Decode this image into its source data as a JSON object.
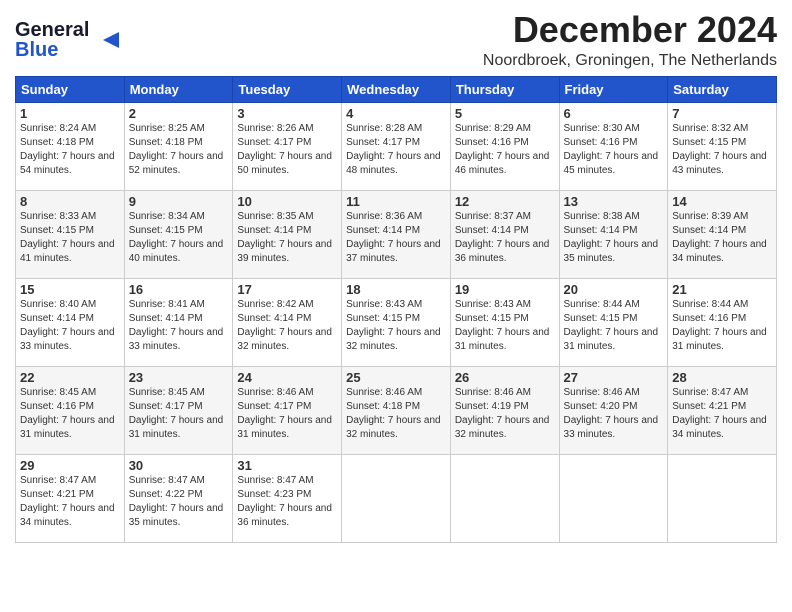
{
  "logo": {
    "line1": "General",
    "line2": "Blue"
  },
  "title": "December 2024",
  "location": "Noordbroek, Groningen, The Netherlands",
  "days_of_week": [
    "Sunday",
    "Monday",
    "Tuesday",
    "Wednesday",
    "Thursday",
    "Friday",
    "Saturday"
  ],
  "weeks": [
    [
      {
        "day": "1",
        "sunrise": "8:24 AM",
        "sunset": "4:18 PM",
        "daylight": "7 hours and 54 minutes."
      },
      {
        "day": "2",
        "sunrise": "8:25 AM",
        "sunset": "4:18 PM",
        "daylight": "7 hours and 52 minutes."
      },
      {
        "day": "3",
        "sunrise": "8:26 AM",
        "sunset": "4:17 PM",
        "daylight": "7 hours and 50 minutes."
      },
      {
        "day": "4",
        "sunrise": "8:28 AM",
        "sunset": "4:17 PM",
        "daylight": "7 hours and 48 minutes."
      },
      {
        "day": "5",
        "sunrise": "8:29 AM",
        "sunset": "4:16 PM",
        "daylight": "7 hours and 46 minutes."
      },
      {
        "day": "6",
        "sunrise": "8:30 AM",
        "sunset": "4:16 PM",
        "daylight": "7 hours and 45 minutes."
      },
      {
        "day": "7",
        "sunrise": "8:32 AM",
        "sunset": "4:15 PM",
        "daylight": "7 hours and 43 minutes."
      }
    ],
    [
      {
        "day": "8",
        "sunrise": "8:33 AM",
        "sunset": "4:15 PM",
        "daylight": "7 hours and 41 minutes."
      },
      {
        "day": "9",
        "sunrise": "8:34 AM",
        "sunset": "4:15 PM",
        "daylight": "7 hours and 40 minutes."
      },
      {
        "day": "10",
        "sunrise": "8:35 AM",
        "sunset": "4:14 PM",
        "daylight": "7 hours and 39 minutes."
      },
      {
        "day": "11",
        "sunrise": "8:36 AM",
        "sunset": "4:14 PM",
        "daylight": "7 hours and 37 minutes."
      },
      {
        "day": "12",
        "sunrise": "8:37 AM",
        "sunset": "4:14 PM",
        "daylight": "7 hours and 36 minutes."
      },
      {
        "day": "13",
        "sunrise": "8:38 AM",
        "sunset": "4:14 PM",
        "daylight": "7 hours and 35 minutes."
      },
      {
        "day": "14",
        "sunrise": "8:39 AM",
        "sunset": "4:14 PM",
        "daylight": "7 hours and 34 minutes."
      }
    ],
    [
      {
        "day": "15",
        "sunrise": "8:40 AM",
        "sunset": "4:14 PM",
        "daylight": "7 hours and 33 minutes."
      },
      {
        "day": "16",
        "sunrise": "8:41 AM",
        "sunset": "4:14 PM",
        "daylight": "7 hours and 33 minutes."
      },
      {
        "day": "17",
        "sunrise": "8:42 AM",
        "sunset": "4:14 PM",
        "daylight": "7 hours and 32 minutes."
      },
      {
        "day": "18",
        "sunrise": "8:43 AM",
        "sunset": "4:15 PM",
        "daylight": "7 hours and 32 minutes."
      },
      {
        "day": "19",
        "sunrise": "8:43 AM",
        "sunset": "4:15 PM",
        "daylight": "7 hours and 31 minutes."
      },
      {
        "day": "20",
        "sunrise": "8:44 AM",
        "sunset": "4:15 PM",
        "daylight": "7 hours and 31 minutes."
      },
      {
        "day": "21",
        "sunrise": "8:44 AM",
        "sunset": "4:16 PM",
        "daylight": "7 hours and 31 minutes."
      }
    ],
    [
      {
        "day": "22",
        "sunrise": "8:45 AM",
        "sunset": "4:16 PM",
        "daylight": "7 hours and 31 minutes."
      },
      {
        "day": "23",
        "sunrise": "8:45 AM",
        "sunset": "4:17 PM",
        "daylight": "7 hours and 31 minutes."
      },
      {
        "day": "24",
        "sunrise": "8:46 AM",
        "sunset": "4:17 PM",
        "daylight": "7 hours and 31 minutes."
      },
      {
        "day": "25",
        "sunrise": "8:46 AM",
        "sunset": "4:18 PM",
        "daylight": "7 hours and 32 minutes."
      },
      {
        "day": "26",
        "sunrise": "8:46 AM",
        "sunset": "4:19 PM",
        "daylight": "7 hours and 32 minutes."
      },
      {
        "day": "27",
        "sunrise": "8:46 AM",
        "sunset": "4:20 PM",
        "daylight": "7 hours and 33 minutes."
      },
      {
        "day": "28",
        "sunrise": "8:47 AM",
        "sunset": "4:21 PM",
        "daylight": "7 hours and 34 minutes."
      }
    ],
    [
      {
        "day": "29",
        "sunrise": "8:47 AM",
        "sunset": "4:21 PM",
        "daylight": "7 hours and 34 minutes."
      },
      {
        "day": "30",
        "sunrise": "8:47 AM",
        "sunset": "4:22 PM",
        "daylight": "7 hours and 35 minutes."
      },
      {
        "day": "31",
        "sunrise": "8:47 AM",
        "sunset": "4:23 PM",
        "daylight": "7 hours and 36 minutes."
      },
      null,
      null,
      null,
      null
    ]
  ],
  "labels": {
    "sunrise": "Sunrise:",
    "sunset": "Sunset:",
    "daylight": "Daylight:"
  }
}
